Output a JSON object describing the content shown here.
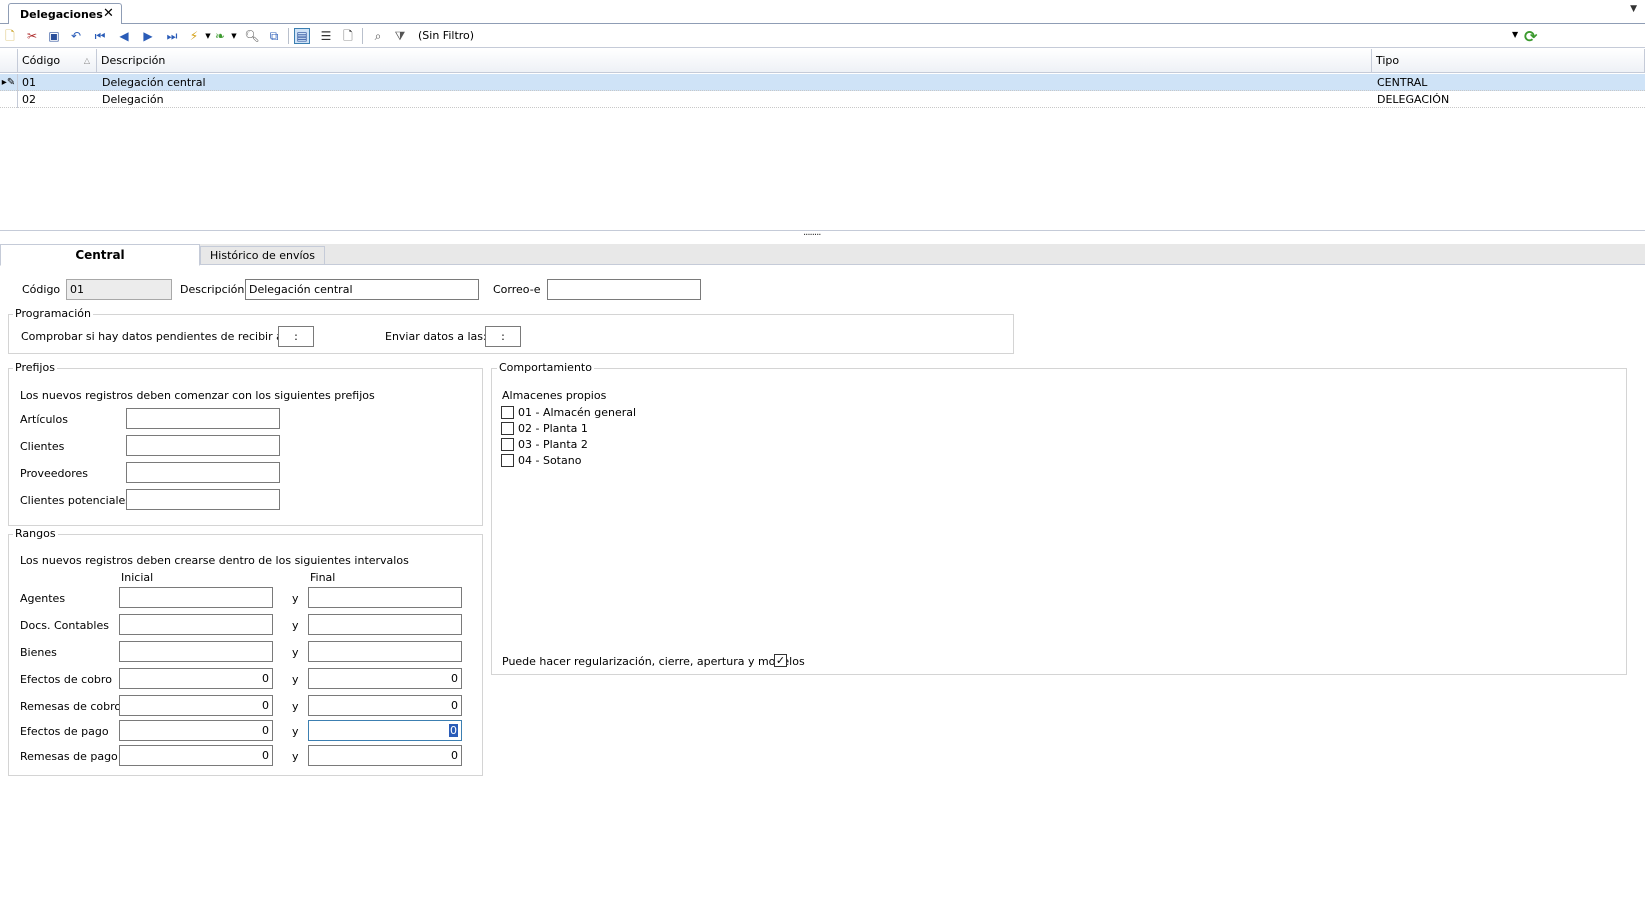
{
  "doc_tab": {
    "title": "Delegaciones",
    "close": "✕"
  },
  "toolbar": {
    "filter_label": "(Sin Filtro)"
  },
  "grid": {
    "columns": [
      "Código",
      "Descripción",
      "Tipo"
    ],
    "rows": [
      {
        "codigo": "01",
        "descripcion": "Delegación central",
        "tipo": "CENTRAL"
      },
      {
        "codigo": "02",
        "descripcion": "Delegación",
        "tipo": "DELEGACIÓN"
      }
    ]
  },
  "splitter_grip": "........",
  "tabs": {
    "central": "Central",
    "historico": "Histórico de envíos"
  },
  "form": {
    "codigo_label": "Código",
    "codigo_value": "01",
    "descripcion_label": "Descripción",
    "descripcion_value": "Delegación central",
    "correo_label": "Correo-e",
    "correo_value": ""
  },
  "programacion": {
    "title": "Programación",
    "comprobar_label": "Comprobar si hay datos pendientes de recibir a las:",
    "comprobar_value": ":",
    "enviar_label": "Enviar datos a las:",
    "enviar_value": ":"
  },
  "prefijos": {
    "title": "Prefijos",
    "intro": "Los nuevos registros deben comenzar con los siguientes prefijos",
    "fields": [
      "Artículos",
      "Clientes",
      "Proveedores",
      "Clientes potenciales"
    ]
  },
  "rangos": {
    "title": "Rangos",
    "intro": "Los nuevos registros deben crearse dentro de los siguientes intervalos",
    "inicial": "Inicial",
    "final": "Final",
    "y": "y",
    "rows": [
      {
        "label": "Agentes",
        "inicial": "",
        "final": ""
      },
      {
        "label": "Docs. Contables",
        "inicial": "",
        "final": ""
      },
      {
        "label": "Bienes",
        "inicial": "",
        "final": ""
      },
      {
        "label": "Efectos de cobro",
        "inicial": "0",
        "final": "0"
      },
      {
        "label": "Remesas de cobro",
        "inicial": "0",
        "final": "0"
      },
      {
        "label": "Efectos de pago",
        "inicial": "0",
        "final": "0"
      },
      {
        "label": "Remesas de pago",
        "inicial": "0",
        "final": "0"
      }
    ]
  },
  "comportamiento": {
    "title": "Comportamiento",
    "almacenes_label": "Almacenes propios",
    "almacenes": [
      "01 - Almacén general",
      "02 - Planta 1",
      "03 - Planta 2",
      "04 - Sotano"
    ],
    "regularizacion_label": "Puede hacer regularización, cierre, apertura y modelos",
    "regularizacion_checked": "✓"
  }
}
